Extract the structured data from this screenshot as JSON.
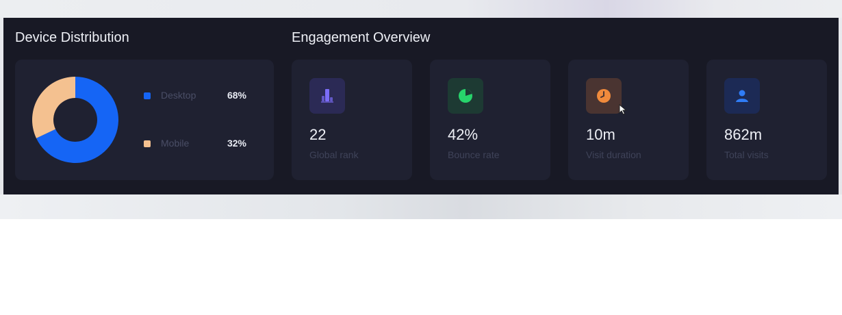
{
  "device_distribution": {
    "title": "Device Distribution",
    "legend": [
      {
        "label": "Desktop",
        "value": "68%",
        "percent": 68,
        "color": "#1565f5"
      },
      {
        "label": "Mobile",
        "value": "32%",
        "percent": 32,
        "color": "#f4c190"
      }
    ]
  },
  "engagement": {
    "title": "Engagement Overview",
    "metrics": [
      {
        "value": "22",
        "label": "Global rank",
        "icon": "bar-chart-icon",
        "tile_color": "#2b2a55",
        "icon_color": "#7b6cf6"
      },
      {
        "value": "42%",
        "label": "Bounce rate",
        "icon": "pie-chart-icon",
        "tile_color": "#1d3a33",
        "icon_color": "#27d46b"
      },
      {
        "value": "10m",
        "label": "Visit duration",
        "icon": "clock-icon",
        "tile_color": "#4a3431",
        "icon_color": "#f08a3c"
      },
      {
        "value": "862m",
        "label": "Total visits",
        "icon": "user-icon",
        "tile_color": "#1c2a55",
        "icon_color": "#2f7cf6"
      }
    ]
  }
}
